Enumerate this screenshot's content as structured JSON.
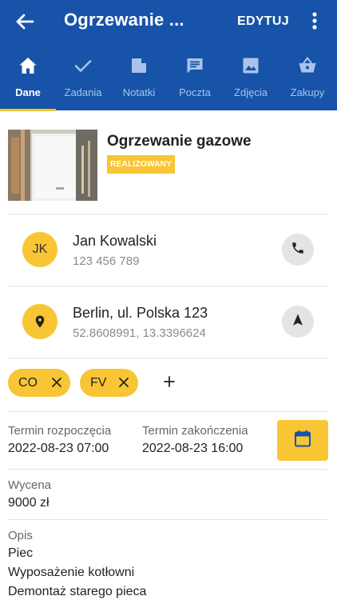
{
  "header": {
    "title": "Ogrzewanie ...",
    "edit_label": "EDYTUJ",
    "back_icon": "arrow-left-icon",
    "more_icon": "more-vertical-icon"
  },
  "tabs": [
    {
      "label": "Dane",
      "icon": "home-icon",
      "active": true
    },
    {
      "label": "Zadania",
      "icon": "check-icon",
      "active": false
    },
    {
      "label": "Notatki",
      "icon": "note-icon",
      "active": false
    },
    {
      "label": "Poczta",
      "icon": "message-icon",
      "active": false
    },
    {
      "label": "Zdjęcia",
      "icon": "image-icon",
      "active": false
    },
    {
      "label": "Zakupy",
      "icon": "basket-icon",
      "active": false
    }
  ],
  "job": {
    "title": "Ogrzewanie gazowe",
    "status": "REALIZOWANY"
  },
  "contact": {
    "initials": "JK",
    "name": "Jan Kowalski",
    "phone": "123 456 789",
    "call_icon": "phone-icon"
  },
  "location": {
    "address": "Berlin, ul. Polska 123",
    "coords": "52.8608991, 13.3396624",
    "pin_icon": "location-pin-icon",
    "nav_icon": "navigation-arrow-icon"
  },
  "tags": [
    {
      "label": "CO"
    },
    {
      "label": "FV"
    }
  ],
  "add_tag_label": "+",
  "schedule": {
    "start_label": "Termin rozpoczęcia",
    "start_value": "2022-08-23 07:00",
    "end_label": "Termin zakończenia",
    "end_value": "2022-08-23 16:00",
    "calendar_icon": "calendar-icon"
  },
  "estimate": {
    "label": "Wycena",
    "value": "9000 zł"
  },
  "description": {
    "label": "Opis",
    "lines": [
      "Piec",
      "Wyposażenie kotłowni",
      "Demontaż starego pieca"
    ]
  },
  "colors": {
    "primary": "#1753a8",
    "accent": "#f8c534",
    "tab_inactive": "#a9c4ea"
  }
}
